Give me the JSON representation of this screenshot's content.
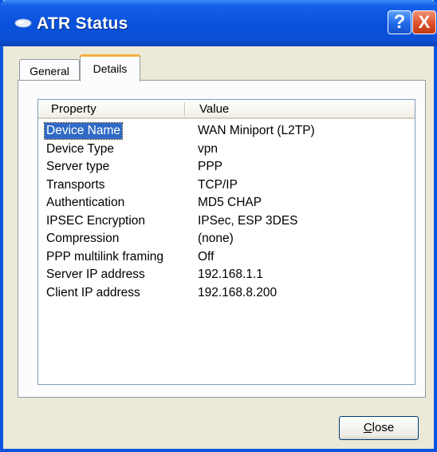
{
  "window": {
    "title": "ATR Status",
    "help_label": "?",
    "close_glyph": "X"
  },
  "tabs": [
    {
      "label": "General",
      "selected": false
    },
    {
      "label": "Details",
      "selected": true
    }
  ],
  "listview": {
    "columns": [
      "Property",
      "Value"
    ],
    "rows": [
      {
        "property": "Device Name",
        "value": "WAN Miniport (L2TP)",
        "selected": true
      },
      {
        "property": "Device Type",
        "value": "vpn"
      },
      {
        "property": "Server type",
        "value": "PPP"
      },
      {
        "property": "Transports",
        "value": "TCP/IP"
      },
      {
        "property": "Authentication",
        "value": "MD5 CHAP"
      },
      {
        "property": "IPSEC Encryption",
        "value": "IPSec, ESP 3DES"
      },
      {
        "property": "Compression",
        "value": "(none)"
      },
      {
        "property": "PPP multilink framing",
        "value": "Off"
      },
      {
        "property": "Server IP address",
        "value": "192.168.1.1"
      },
      {
        "property": "Client IP address",
        "value": "192.168.8.200"
      }
    ]
  },
  "footer": {
    "close_label_underlined": "C",
    "close_label_rest": "lose"
  },
  "colors": {
    "titlebar": "#0a52dc",
    "selection": "#316ac5",
    "tab_highlight": "#f6b13c",
    "dialog_bg": "#ece9d8"
  }
}
